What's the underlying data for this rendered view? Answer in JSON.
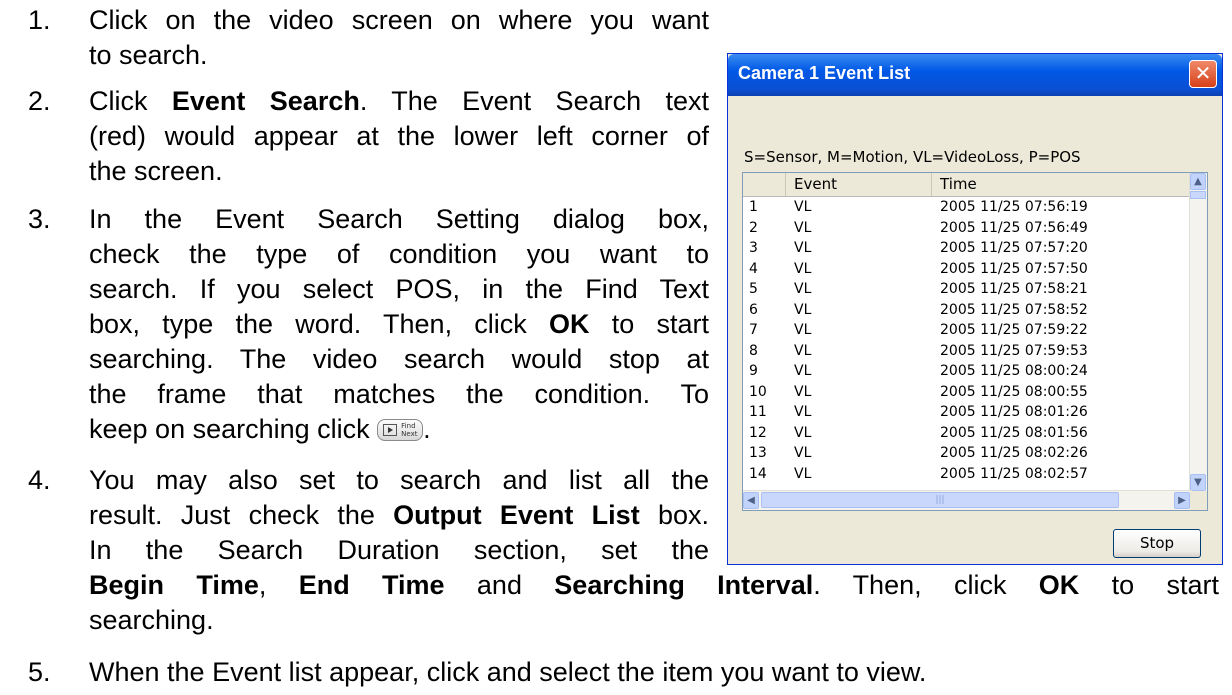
{
  "steps": [
    {
      "num": "1.",
      "lines": [
        "Click on the video screen on where you want",
        "to search."
      ]
    },
    {
      "num": "2.",
      "a": "Click ",
      "b": "Event Search",
      "c": ". The Event Search text",
      "lines": [
        "(red) would appear at the lower left corner of",
        "the screen."
      ]
    },
    {
      "num": "3.",
      "lines": [
        "In the Event Search Setting dialog box,",
        "check the type of condition you want to",
        "search. If you select POS, in the Find Text"
      ],
      "l4a": "box, type the word. Then, click ",
      "l4b": "OK",
      "l4c": " to start",
      "l5": "searching. The video search would stop at",
      "l6": "the frame that matches the condition. To",
      "l7": "keep on searching click",
      "l7end": "."
    },
    {
      "num": "4.",
      "l1": "You may also set to search and list all the",
      "l2a": "result. Just check the ",
      "l2b": "Output Event List",
      "l2c": " box.",
      "l3": "In the Search Duration section, set the",
      "l4b1": "Begin Time",
      "l4a": ", ",
      "l4b2": "End Time",
      "l4c": " and ",
      "l4b3": "Searching Interval",
      "l4d": ". Then, click ",
      "l4b4": "OK",
      "l4e": " to start",
      "l5": "searching."
    },
    {
      "num": "5.",
      "text": "When the Event list appear, click and select the item you want to view."
    }
  ],
  "find_next_button": {
    "label1": "Find",
    "label2": "Next",
    "icon": "play-frame-icon"
  },
  "dialog": {
    "title": "Camera 1  Event List",
    "close_icon": "close-icon",
    "legend": "S=Sensor, M=Motion, VL=VideoLoss, P=POS",
    "columns": [
      "",
      "Event",
      "Time"
    ],
    "rows": [
      [
        "1",
        "VL",
        "2005 11/25 07:56:19"
      ],
      [
        "2",
        "VL",
        "2005 11/25 07:56:49"
      ],
      [
        "3",
        "VL",
        "2005 11/25 07:57:20"
      ],
      [
        "4",
        "VL",
        "2005 11/25 07:57:50"
      ],
      [
        "5",
        "VL",
        "2005 11/25 07:58:21"
      ],
      [
        "6",
        "VL",
        "2005 11/25 07:58:52"
      ],
      [
        "7",
        "VL",
        "2005 11/25 07:59:22"
      ],
      [
        "8",
        "VL",
        "2005 11/25 07:59:53"
      ],
      [
        "9",
        "VL",
        "2005 11/25 08:00:24"
      ],
      [
        "10",
        "VL",
        "2005 11/25 08:00:55"
      ],
      [
        "11",
        "VL",
        "2005 11/25 08:01:26"
      ],
      [
        "12",
        "VL",
        "2005 11/25 08:01:56"
      ],
      [
        "13",
        "VL",
        "2005 11/25 08:02:26"
      ],
      [
        "14",
        "VL",
        "2005 11/25 08:02:57"
      ]
    ],
    "stop_label": "Stop"
  },
  "colors": {
    "titlebar": "#0058e6",
    "dialog_bg": "#ece9d8",
    "close": "#d6401a"
  }
}
